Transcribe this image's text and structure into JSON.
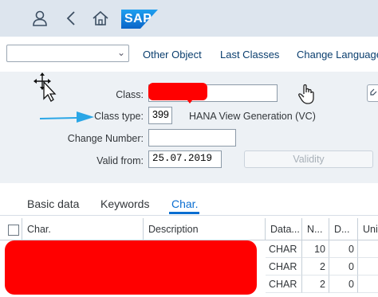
{
  "shell": {
    "logo_text": "SAP"
  },
  "toolbar": {
    "select_value": "",
    "links": [
      "Other Object",
      "Last Classes",
      "Change Language"
    ]
  },
  "form": {
    "class_label": "Class:",
    "class_value": "",
    "class_type_label": "Class type:",
    "class_type_value": "399",
    "class_type_desc": "HANA View Generation (VC)",
    "change_number_label": "Change Number:",
    "change_number_value": "",
    "valid_from_label": "Valid from:",
    "valid_from_value": "25.07.2019",
    "validity_button": "Validity"
  },
  "tabs": [
    "Basic data",
    "Keywords",
    "Char."
  ],
  "active_tab": "Char.",
  "table": {
    "headers": [
      "Char.",
      "Description",
      "Data...",
      "N...",
      "D...",
      "Uni"
    ],
    "rows": [
      {
        "type": "CHAR",
        "n": "10",
        "d": "0"
      },
      {
        "type": "CHAR",
        "n": "2",
        "d": "0"
      },
      {
        "type": "CHAR",
        "n": "2",
        "d": "0"
      }
    ]
  },
  "colors": {
    "accent": "#0a6ed1",
    "shell_bg": "#dde5ee",
    "form_bg": "#edf1f5",
    "redaction": "#ff0000",
    "arrow": "#2aa6e6"
  }
}
